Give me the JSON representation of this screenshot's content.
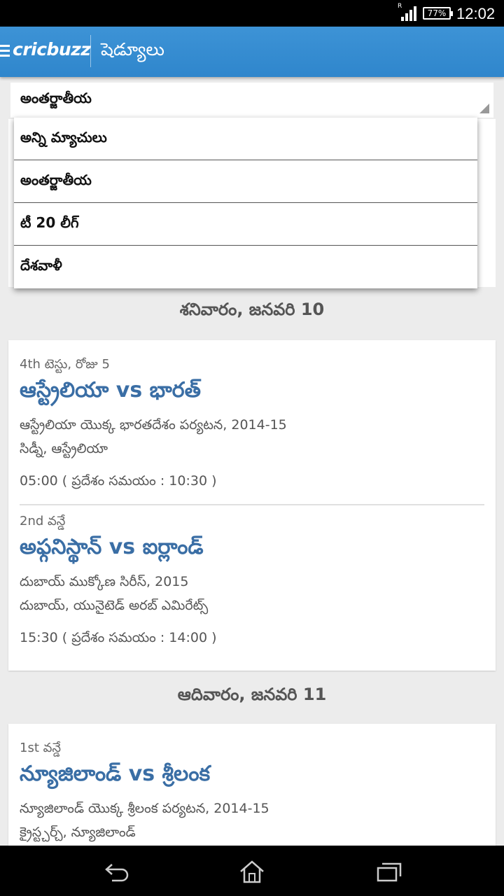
{
  "status_bar": {
    "time": "12:02",
    "battery": "77%",
    "roaming": "R"
  },
  "app_bar": {
    "logo": "cricbuzz",
    "title": "షెడ్యూలు"
  },
  "filter": {
    "selected": "అంతర్జాతీయ",
    "options": [
      "అన్ని మ్యాచులు",
      "అంతర్జాతీయ",
      "టీ 20 లీగ్",
      "దేశవాళీ"
    ]
  },
  "days": [
    {
      "date": "శనివారం, జనవరి 10",
      "matches": [
        {
          "type": "4th టెస్టు, రోజు 5",
          "title": "ఆస్ట్రేలియా vs భారత్",
          "series": "ఆస్ట్రేలియా యొక్క భారతదేశం పర్యటన, 2014-15",
          "venue": "సిడ్నీ, ఆస్ట్రేలియా",
          "time": "05:00 ( ప్రదేశం సమయం : 10:30 )"
        },
        {
          "type": "2nd వన్డే",
          "title": "అఫ్గనిస్థాన్ vs ఐర్లాండ్",
          "series": "దుబాయ్ ముక్కోణ సిరీస్, 2015",
          "venue": "దుబాయ్, యునైటెడ్ అరబ్ ఎమిరేట్స్",
          "time": "15:30 ( ప్రదేశం సమయం : 14:00 )"
        }
      ]
    },
    {
      "date": "ఆదివారం, జనవరి 11",
      "matches": [
        {
          "type": "1st వన్డే",
          "title": "న్యూజిలాండ్ vs శ్రీలంక",
          "series": "న్యూజిలాండ్ యొక్క శ్రీలంక పర్యటన, 2014-15",
          "venue": "క్రైస్ట్చర్చ్, న్యూజిలాండ్"
        }
      ]
    }
  ],
  "colors": {
    "app_bar": "#3d93d6",
    "match_title": "#3a6ea5",
    "background": "#ececec"
  }
}
